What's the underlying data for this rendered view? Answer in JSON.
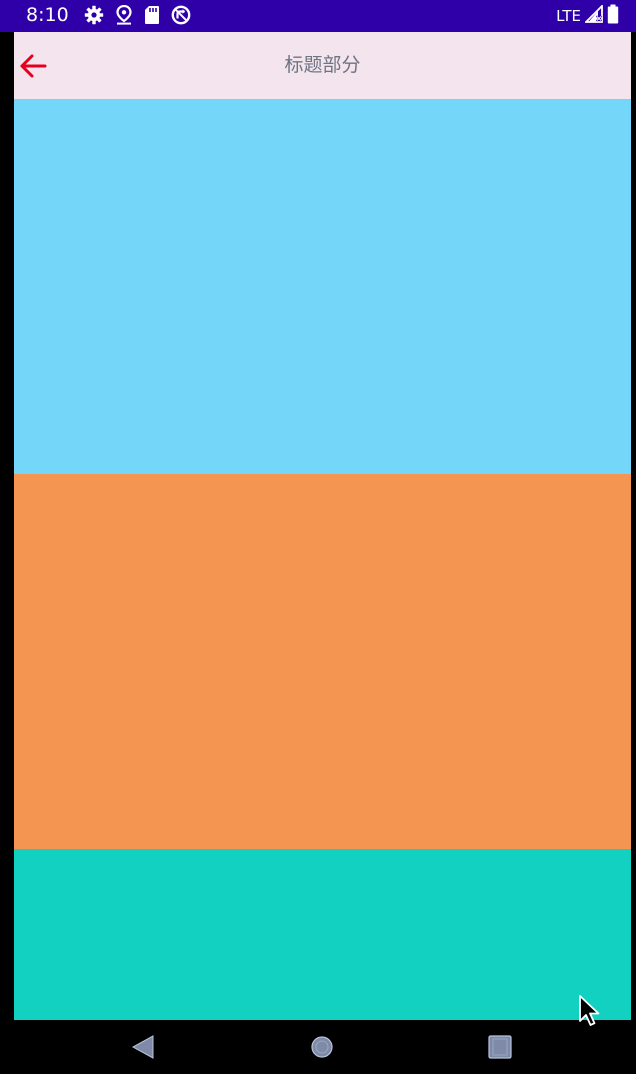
{
  "status_bar": {
    "time": "8:10",
    "network": "LTE",
    "background_color": "#2f00a8",
    "icons_left": [
      "gear-icon",
      "location-pin-icon",
      "sd-card-icon",
      "no-sync-icon"
    ],
    "icons_right": [
      "signal-icon",
      "battery-icon"
    ]
  },
  "toolbar": {
    "title": "标题部分",
    "back_icon": "arrow-left-icon",
    "background_color": "#f3e4ed",
    "accent_color": "#e4001e"
  },
  "panels": [
    {
      "name": "light-blue",
      "color": "#74d6f9"
    },
    {
      "name": "orange",
      "color": "#f49651"
    },
    {
      "name": "teal",
      "color": "#12d1c0"
    }
  ],
  "nav_bar": {
    "buttons": [
      "back-triangle-icon",
      "home-circle-icon",
      "recents-square-icon"
    ]
  }
}
